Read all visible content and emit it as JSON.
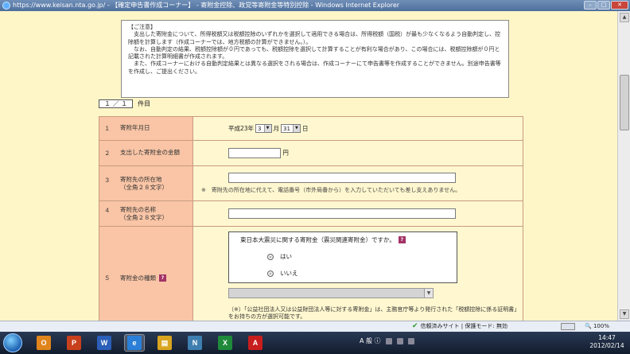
{
  "window": {
    "title": "https://www.keisan.nta.go.jp/ - 【確定申告書作成コーナー】 - 寄附金控除、政党等寄附金等特別控除 - Windows Internet Explorer"
  },
  "notice": {
    "heading": "【ご注意】",
    "lines": [
      "支出した寄附金について、所得税額又は税額控除のいずれかを選択して適用できる場合は、所得税額（国税）が最も少なくなるよう自動判定し、控除額を計算します（作成コーナーでは、地方税額の計算ができません。）。",
      "なお、自動判定の結果、税額控除額が０円であっても、税額控除を選択して計算することが有利な場合があり、この場合には、税額控除額が０円と記載された計算明細書が作成されます。",
      "また、作成コーナーにおける自動判定結果とは異なる選択をされる場合は、作成コーナーにて申告書等を作成することができません。別途申告書等を作成し、ご提出ください。"
    ]
  },
  "counter": {
    "page": "１ ／ １",
    "suffix": "件目"
  },
  "form": {
    "row1": {
      "num": "１",
      "label": "寄附年月日",
      "era": "平成23年",
      "month": "3",
      "month_unit": "月",
      "day": "31",
      "day_unit": "日"
    },
    "row2": {
      "num": "２",
      "label": "支出した寄附金の金額",
      "unit": "円",
      "amount": ""
    },
    "row3": {
      "num": "３",
      "label": "寄附先の所在地",
      "sub": "（全角２８文字）",
      "value": "",
      "note": "※　寄附先の所在地に代えて、電話番号（市外局番から）を入力していただいても差し支えありません。"
    },
    "row4": {
      "num": "４",
      "label": "寄附先の名称",
      "sub": "（全角２８文字）",
      "value": ""
    },
    "row5": {
      "num": "５",
      "label": "寄附金の種類",
      "question": "東日本大震災に関する寄附金（震災関連寄附金）ですか。",
      "opt_yes": "はい",
      "opt_no": "いいえ",
      "select_value": "",
      "bottom_note": "（※）「公益社団法人又は公益財団法人等に対する寄附金」は、主務官庁等より発行された「税額控除に係る証明書」をお持ちの方が選択可能です。"
    }
  },
  "status": {
    "zone": "信頼済みサイト | 保護モード: 無効",
    "zoom": "100%"
  },
  "taskbar": {
    "apps": [
      {
        "label": "O",
        "color": "#e0841c",
        "icon": "outlook-icon"
      },
      {
        "label": "P",
        "color": "#c8401c",
        "icon": "powerpoint-icon"
      },
      {
        "label": "W",
        "color": "#2b5fb8",
        "icon": "word-icon"
      },
      {
        "label": "e",
        "color": "#2b7fd8",
        "icon": "ie-icon"
      },
      {
        "label": "▤",
        "color": "#d9a520",
        "icon": "folder-icon"
      },
      {
        "label": "N",
        "color": "#3f7fb0",
        "icon": "app-n-icon"
      },
      {
        "label": "X",
        "color": "#1f8a3a",
        "icon": "excel-icon"
      },
      {
        "label": "A",
        "color": "#c81e1e",
        "icon": "acrobat-icon"
      }
    ],
    "tray_text": "A 般 ⓘ",
    "time": "14:47",
    "date": "2012/02/14"
  },
  "colors": {
    "page_bg": "#fff6c8",
    "label_bg": "#f9c5a6",
    "help_badge": "#a33366"
  }
}
